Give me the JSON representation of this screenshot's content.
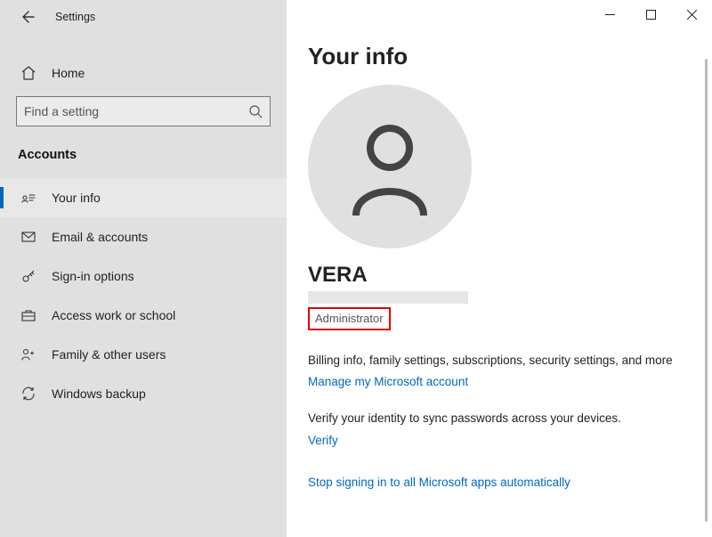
{
  "window": {
    "title": "Settings",
    "page_title": "Your info"
  },
  "sidebar": {
    "home_label": "Home",
    "search_placeholder": "Find a setting",
    "section_header": "Accounts",
    "items": [
      {
        "label": "Your info",
        "icon": "person-card-icon",
        "active": true
      },
      {
        "label": "Email & accounts",
        "icon": "mail-icon",
        "active": false
      },
      {
        "label": "Sign-in options",
        "icon": "key-icon",
        "active": false
      },
      {
        "label": "Access work or school",
        "icon": "briefcase-icon",
        "active": false
      },
      {
        "label": "Family & other users",
        "icon": "family-icon",
        "active": false
      },
      {
        "label": "Windows backup",
        "icon": "sync-icon",
        "active": false
      }
    ]
  },
  "profile": {
    "user_name": "VERA",
    "role": "Administrator",
    "billing_text": "Billing info, family settings, subscriptions, security settings, and more",
    "manage_link": "Manage my Microsoft account",
    "verify_text": "Verify your identity to sync passwords across your devices.",
    "verify_link": "Verify",
    "stop_link": "Stop signing in to all Microsoft apps automatically"
  },
  "highlight": {
    "note": "Red box highlight around Administrator role"
  }
}
